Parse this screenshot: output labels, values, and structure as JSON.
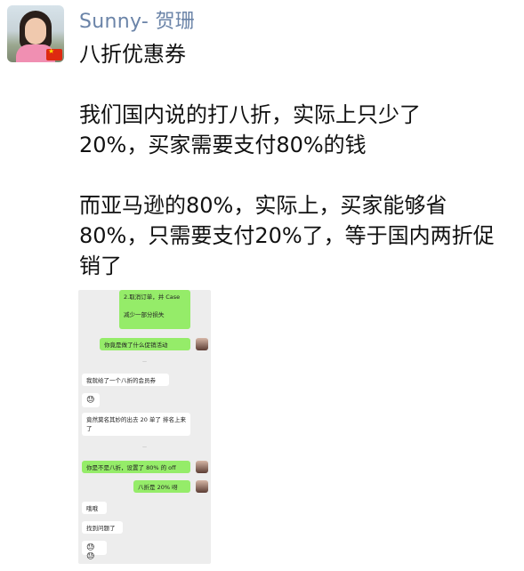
{
  "sender": {
    "name": "Sunny- 贺珊"
  },
  "message": {
    "text": "八折优惠券\n\n我们国内说的打八折，实际上只少了\n20%，买家需要支付80%的钱\n\n而亚马逊的80%，实际上，买家能够省\n80%，只需要支付20%了，等于国内两折促\n销了"
  },
  "screenshot": {
    "bubbles": [
      {
        "side": "right",
        "text": "2.取消订单，并 Case\n\n减少一部分损失"
      },
      {
        "side": "right",
        "text": "你竟是做了什么促销活动"
      },
      {
        "side": "left",
        "text": "我就给了一个八折的会员券"
      },
      {
        "side": "left",
        "text": "😓"
      },
      {
        "side": "left",
        "text": "竟然莫名其妙的出去 20 单了  排名上来了"
      },
      {
        "side": "right",
        "text": "你是不是八折，设置了 80% 的 off"
      },
      {
        "side": "right",
        "text": "八折是 20% 呀"
      },
      {
        "side": "left",
        "text": "哦哦"
      },
      {
        "side": "left",
        "text": "找到问题了"
      },
      {
        "side": "left",
        "text": "😓😓"
      }
    ]
  },
  "colors": {
    "sender": "#6b84a8",
    "outgoing_bubble": "#95ec69",
    "incoming_bubble": "#ffffff",
    "chat_bg": "#ededed"
  }
}
